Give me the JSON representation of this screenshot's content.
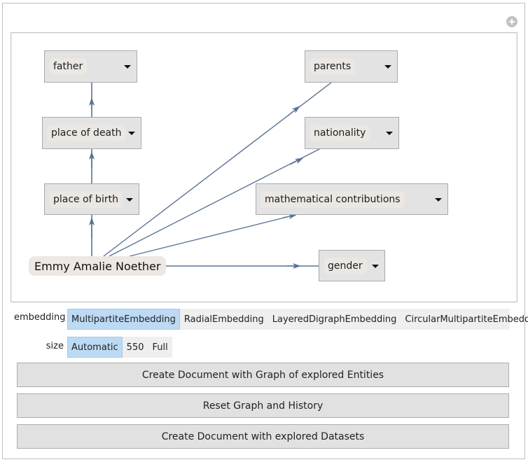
{
  "graph": {
    "root": {
      "label": "Emmy Amalie Noether"
    },
    "nodes": [
      {
        "id": "father",
        "label": "father"
      },
      {
        "id": "place-of-death",
        "label": "place of death"
      },
      {
        "id": "place-of-birth",
        "label": "place of birth"
      },
      {
        "id": "parents",
        "label": "parents"
      },
      {
        "id": "nationality",
        "label": "nationality"
      },
      {
        "id": "mathematical-contributions",
        "label": "mathematical contributions"
      },
      {
        "id": "gender",
        "label": "gender"
      }
    ],
    "edges": [
      {
        "from": "Emmy Amalie Noether",
        "to": "place of birth"
      },
      {
        "from": "place of birth",
        "to": "place of death"
      },
      {
        "from": "place of death",
        "to": "father"
      },
      {
        "from": "Emmy Amalie Noether",
        "to": "parents"
      },
      {
        "from": "Emmy Amalie Noether",
        "to": "nationality"
      },
      {
        "from": "Emmy Amalie Noether",
        "to": "mathematical contributions"
      },
      {
        "from": "Emmy Amalie Noether",
        "to": "gender"
      }
    ],
    "edge_color": "#5a7394"
  },
  "controls": {
    "embedding": {
      "label": "embedding",
      "options": [
        "MultipartiteEmbedding",
        "RadialEmbedding",
        "LayeredDigraphEmbedding",
        "CircularMultipartiteEmbedding"
      ],
      "selected": "MultipartiteEmbedding"
    },
    "size": {
      "label": "size",
      "options": [
        "Automatic",
        "550",
        "Full"
      ],
      "selected": "Automatic"
    }
  },
  "buttons": {
    "create_graph_doc": "Create Document with Graph of explored Entities",
    "reset": "Reset Graph and History",
    "create_datasets_doc": "Create Document with explored Datasets"
  },
  "colors": {
    "selected_option": "#bcdaf3",
    "button_bg": "#e1e1e1",
    "node_bg": "#e3e3e3"
  }
}
